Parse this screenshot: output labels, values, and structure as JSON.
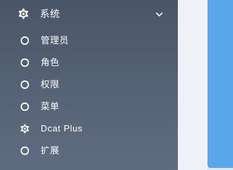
{
  "sidebar": {
    "group": {
      "label": "系统",
      "icon": "gear-icon",
      "expanded": true
    },
    "items": [
      {
        "label": "管理员",
        "icon": "circle-icon"
      },
      {
        "label": "角色",
        "icon": "circle-icon"
      },
      {
        "label": "权限",
        "icon": "circle-icon"
      },
      {
        "label": "菜单",
        "icon": "circle-icon"
      },
      {
        "label": "Dcat Plus",
        "icon": "gear-icon"
      },
      {
        "label": "扩展",
        "icon": "circle-icon"
      }
    ]
  },
  "colors": {
    "sidebar_bg": "#4a5566",
    "text": "#ffffff",
    "page_bg": "#f0f1f6",
    "accent": "#5aa6ea"
  }
}
